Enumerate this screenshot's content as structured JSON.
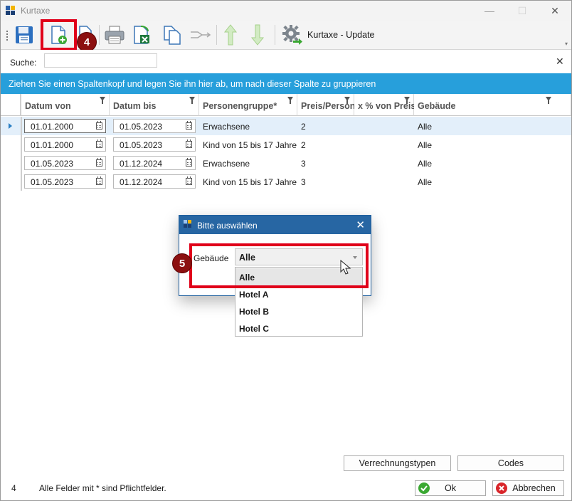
{
  "window": {
    "title": "Kurtaxe",
    "controls": {
      "minimize": "—",
      "maximize": "☐",
      "close": "✕"
    }
  },
  "toolbar": {
    "buttons": [
      {
        "name": "save-icon"
      },
      {
        "name": "new-record-icon"
      },
      {
        "name": "copy-icon"
      },
      {
        "name": "print-icon"
      },
      {
        "name": "excel-export-icon"
      },
      {
        "name": "copy-pages-icon"
      },
      {
        "name": "link-arrows-icon"
      },
      {
        "name": "move-up-icon"
      },
      {
        "name": "move-down-icon"
      },
      {
        "name": "gear-update-icon"
      }
    ],
    "update_label": "Kurtaxe - Update",
    "overflow": "▾"
  },
  "annotations": {
    "badge_4": "4",
    "badge_5": "5"
  },
  "search": {
    "label": "Suche:",
    "value": "",
    "clear": "✕"
  },
  "group_panel": {
    "text": "Ziehen Sie einen Spaltenkopf und legen Sie ihn hier ab, um nach dieser Spalte zu gruppieren"
  },
  "grid": {
    "columns": [
      "Datum von",
      "Datum bis",
      "Personengruppe*",
      "Preis/Person",
      "x % von Preis",
      "Gebäude"
    ],
    "rows": [
      {
        "von": "01.01.2000",
        "bis": "01.05.2023",
        "gruppe": "Erwachsene",
        "preis": "2",
        "prozent": "",
        "gebaeude": "Alle"
      },
      {
        "von": "01.01.2000",
        "bis": "01.05.2023",
        "gruppe": "Kind von 15 bis 17 Jahre",
        "preis": "2",
        "prozent": "",
        "gebaeude": "Alle"
      },
      {
        "von": "01.05.2023",
        "bis": "01.12.2024",
        "gruppe": "Erwachsene",
        "preis": "3",
        "prozent": "",
        "gebaeude": "Alle"
      },
      {
        "von": "01.05.2023",
        "bis": "01.12.2024",
        "gruppe": "Kind von 15 bis 17 Jahre",
        "preis": "3",
        "prozent": "",
        "gebaeude": "Alle"
      }
    ]
  },
  "dialog": {
    "title": "Bitte auswählen",
    "close": "✕",
    "label": "Gebäude",
    "selected": "Alle",
    "options": [
      "Alle",
      "Hotel A",
      "Hotel B",
      "Hotel C"
    ]
  },
  "footer": {
    "verrechnungstypen": "Verrechnungstypen",
    "codes": "Codes",
    "count": "4",
    "hint": "Alle Felder mit * sind Pflichtfelder.",
    "ok": "Ok",
    "abbrechen": "Abbrechen"
  },
  "colors": {
    "accent": "#279fdb",
    "dialog_title": "#2766a3",
    "marker": "#e0001a",
    "badge": "#8c1010"
  }
}
